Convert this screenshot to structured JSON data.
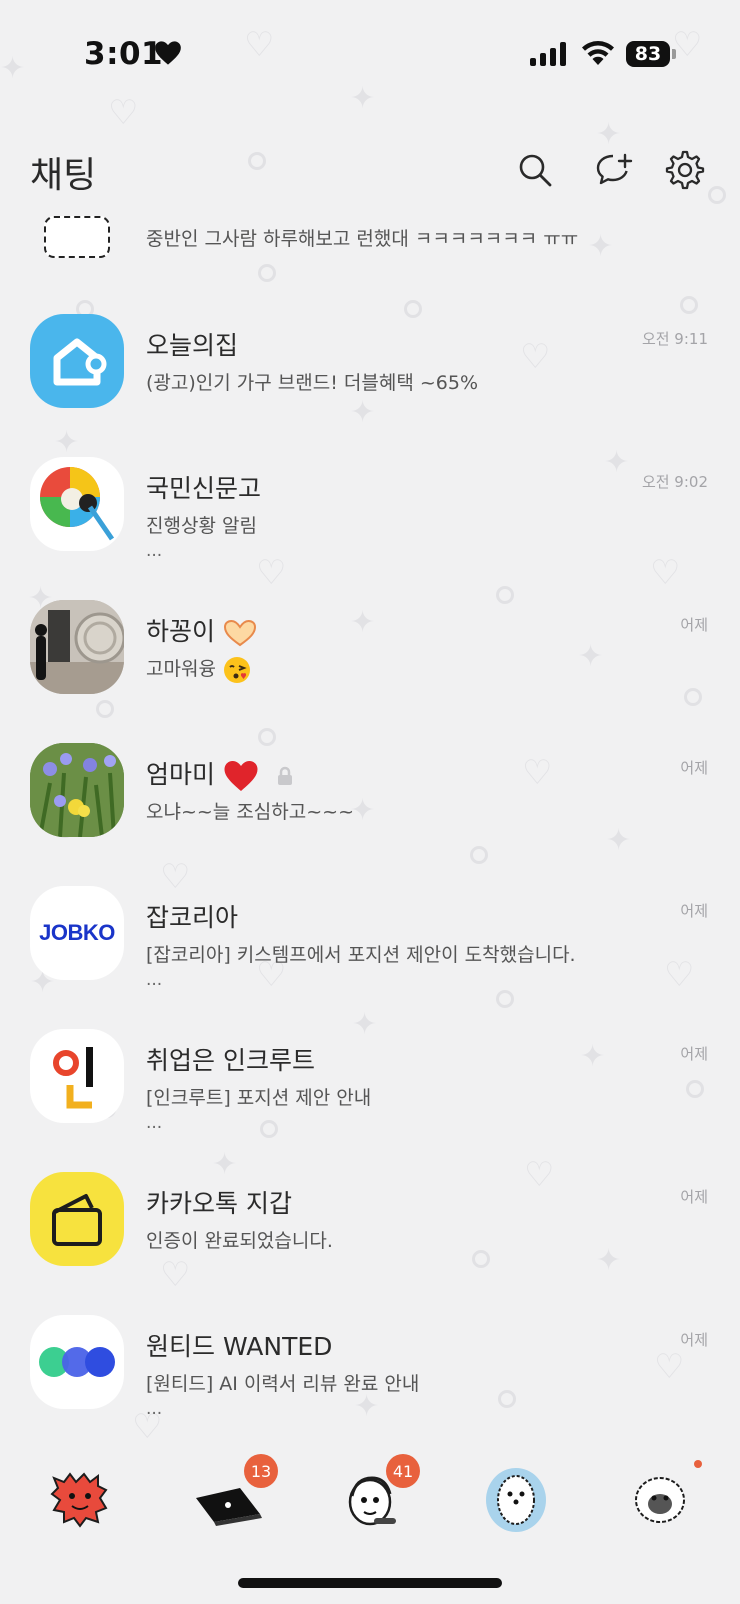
{
  "status_bar": {
    "time": "3:01",
    "battery": "83"
  },
  "header": {
    "title": "채팅",
    "icons": [
      "search-icon",
      "new-chat-icon",
      "settings-icon"
    ]
  },
  "partial_chat": {
    "preview": "중반인 그사람 하루해보고 런했대 ㅋㅋㅋㅋㅋㅋㅋ ㅠㅠ"
  },
  "chats": [
    {
      "name": "오늘의집",
      "preview": "(광고)인기 가구 브랜드! 더블혜택 ~65%",
      "more": "",
      "time": "오전 9:11"
    },
    {
      "name": "국민신문고",
      "preview": "진행상황 알림",
      "more": "...",
      "time": "오전 9:02"
    },
    {
      "name": "하꽁이",
      "preview": "고마워융",
      "more": "",
      "time": "어제"
    },
    {
      "name": "엄마미",
      "preview": "오냐~~늘 조심하고~~~",
      "more": "",
      "time": "어제"
    },
    {
      "name": "잡코리아",
      "preview": "[잡코리아] 키스템프에서 포지션 제안이 도착했습니다.",
      "more": "...",
      "time": "어제"
    },
    {
      "name": "취업은 인크루트",
      "preview": "[인크루트] 포지션 제안 안내",
      "more": "...",
      "time": "어제"
    },
    {
      "name": "카카오톡 지갑",
      "preview": "인증이 완료되었습니다.",
      "more": "",
      "time": "어제"
    },
    {
      "name": "원티드 WANTED",
      "preview": "[원티드] AI 이력서 리뷰 완료 안내",
      "more": "...",
      "time": "어제"
    }
  ],
  "avatars": {
    "jobkorea_logo": "JOBKO"
  },
  "tabbar": {
    "badges": {
      "chats": "13",
      "openchat": "41"
    }
  },
  "colors": {
    "background": "#f1f1f2",
    "badge": "#e8613d",
    "ohouse": "#35c5f0",
    "kakao_wallet": "#f7e23e"
  }
}
